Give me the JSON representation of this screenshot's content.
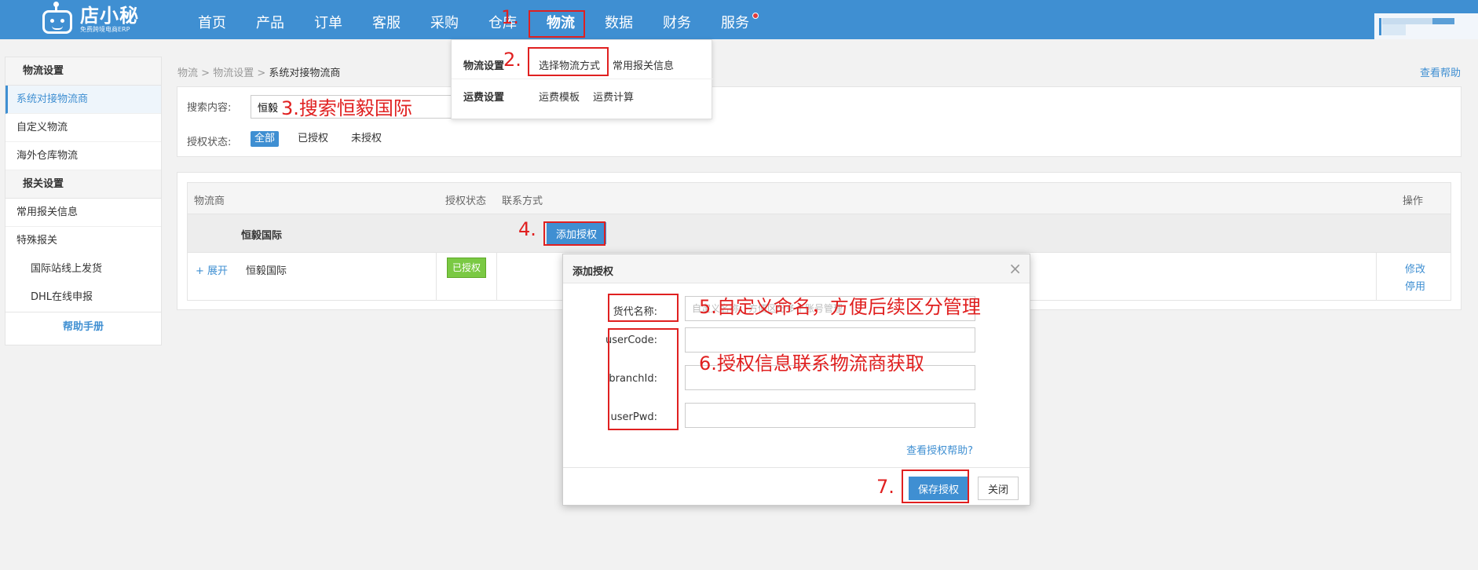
{
  "logo": {
    "name": "店小秘",
    "sub": "免费跨境电商ERP"
  },
  "nav": [
    "首页",
    "产品",
    "订单",
    "客服",
    "采购",
    "仓库",
    "物流",
    "数据",
    "财务",
    "服务"
  ],
  "sidebar": {
    "sections": [
      {
        "title": "物流设置",
        "items": [
          "系统对接物流商",
          "自定义物流",
          "海外仓库物流"
        ]
      },
      {
        "title": "报关设置",
        "items": [
          "常用报关信息",
          "特殊报关"
        ],
        "sub_items": [
          "国际站线上发货",
          "DHL在线申报"
        ]
      }
    ],
    "help": "帮助手册"
  },
  "breadcrumb": {
    "a": "物流",
    "b": "物流设置",
    "c": "系统对接物流商",
    "sep": ">"
  },
  "help_link": "查看帮助",
  "search": {
    "label": "搜索内容:",
    "value": "恒毅",
    "status_label": "授权状态:",
    "status_options": [
      "全部",
      "已授权",
      "未授权"
    ]
  },
  "table": {
    "headers": {
      "carrier": "物流商",
      "status": "授权状态",
      "contact": "联系方式",
      "ops": "操作"
    },
    "group_name": "恒毅国际",
    "add_button": "添加授权",
    "row": {
      "expand": "+ 展开",
      "name": "恒毅国际",
      "status": "已授权",
      "op_edit": "修改",
      "op_disable": "停用"
    }
  },
  "dropdown": {
    "row1_title": "物流设置",
    "row1_link1": "选择物流方式",
    "row1_link2": "常用报关信息",
    "row2_title": "运费设置",
    "row2_link1": "运费模板",
    "row2_link2": "运费计算"
  },
  "modal": {
    "title": "添加授权",
    "close": "×",
    "fields": {
      "alias_label": "货代名称:",
      "alias_placeholder": "自定义名称，方便区分多个账号管理",
      "usercode_label": "userCode:",
      "branchid_label": "branchId:",
      "userpwd_label": "userPwd:"
    },
    "help": "查看授权帮助?",
    "save": "保存授权",
    "cancel": "关闭"
  },
  "annotations": {
    "a1": "1.",
    "a2": "2.",
    "a3": "3.搜索恒毅国际",
    "a4": "4.",
    "a5": "5.自定义命名，方便后续区分管理",
    "a6": "6.授权信息联系物流商获取",
    "a7": "7."
  },
  "colors": {
    "brand": "#3f8fd2",
    "annotation": "#e02020",
    "authorized": "#7ac943"
  }
}
